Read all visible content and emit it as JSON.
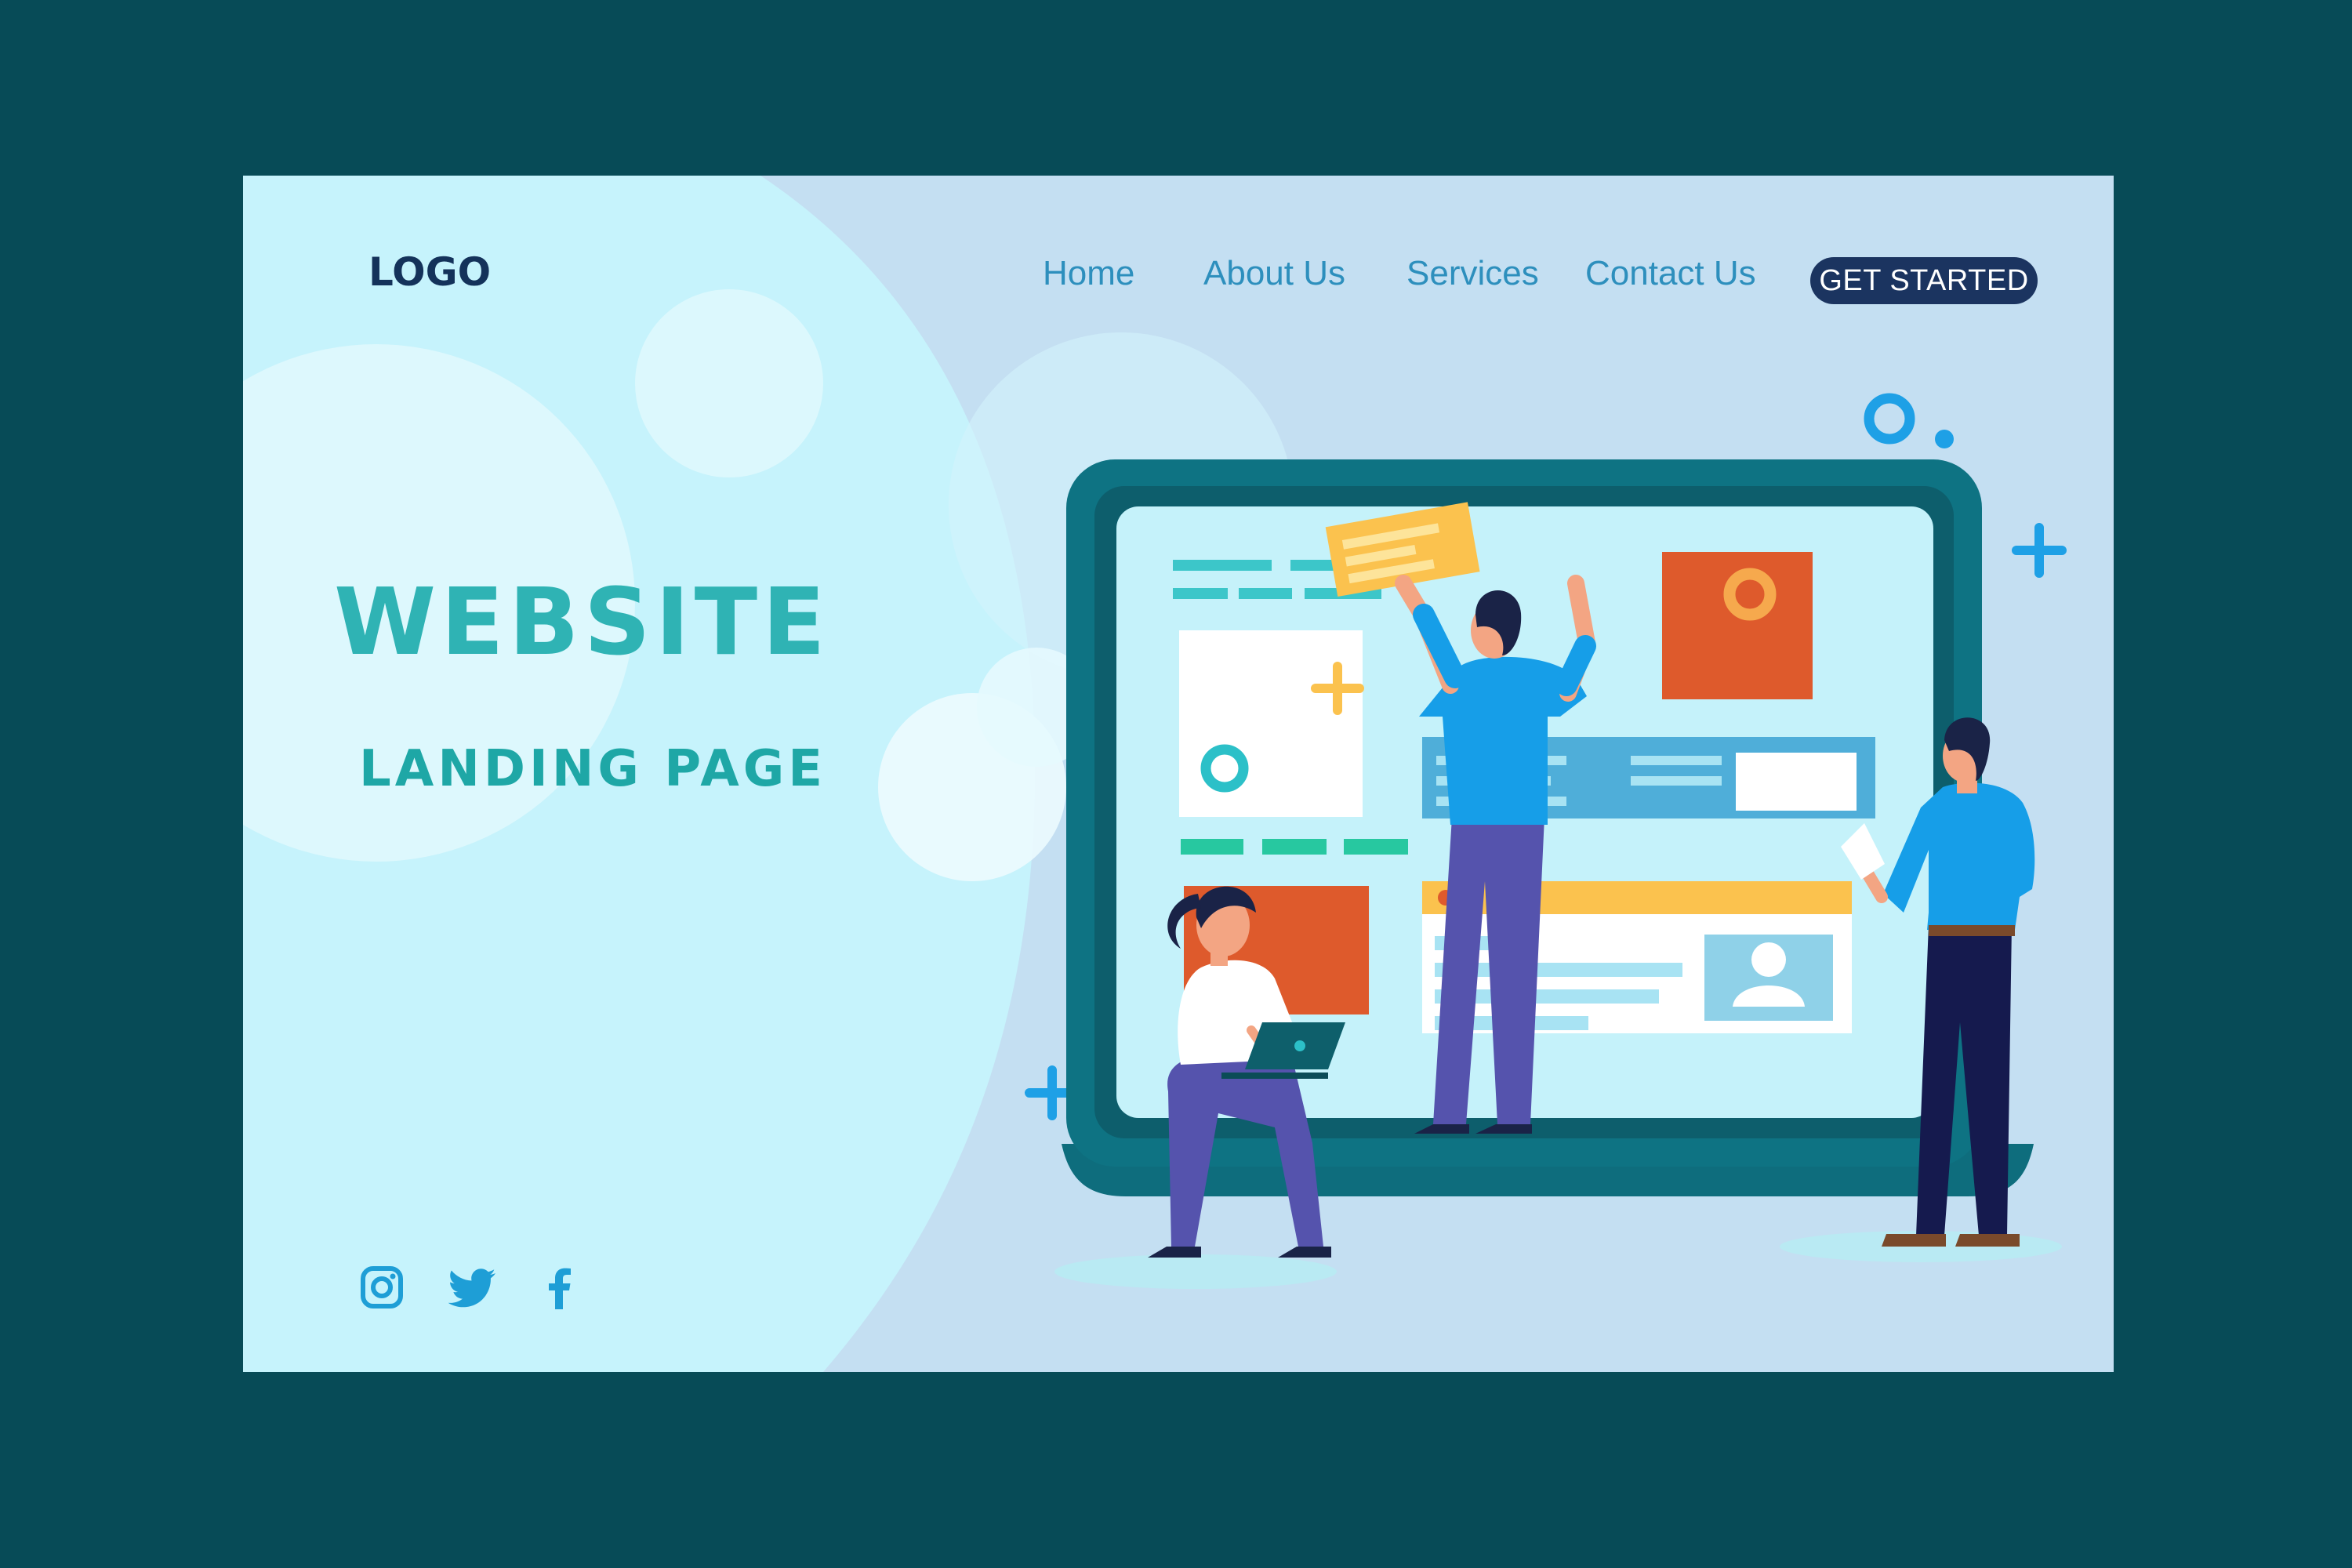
{
  "header": {
    "logo": "LOGO",
    "nav": [
      "Home",
      "About Us",
      "Services",
      "Contact Us"
    ],
    "cta": "GET STARTED"
  },
  "hero": {
    "title": "WEBSITE",
    "subtitle": "LANDING PAGE"
  },
  "social": [
    "instagram-icon",
    "twitter-icon",
    "facebook-icon"
  ],
  "colors": {
    "background": "#074b57",
    "page": "#c4dff2",
    "left_panel": "#c6f3fc",
    "title": "#2fb3b4",
    "nav": "#2d8fbd",
    "cta": "#1b3460",
    "laptop": "#0e7383",
    "accent_orange": "#de5a2c",
    "accent_yellow": "#fbc24e"
  }
}
